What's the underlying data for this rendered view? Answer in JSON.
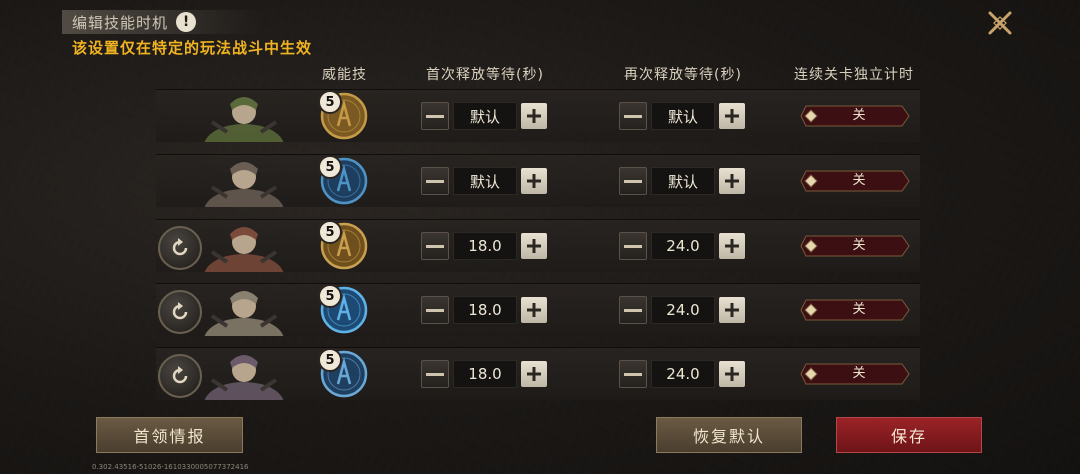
{
  "header": {
    "title": "编辑技能时机",
    "info_icon": "!",
    "subtitle": "该设置仅在特定的玩法战斗中生效"
  },
  "columns": {
    "skill": "威能技",
    "first_wait": "首次释放等待(秒)",
    "repeat_wait": "再次释放等待(秒)",
    "independent_timer": "连续关卡独立计时"
  },
  "rows": [
    {
      "has_reset": false,
      "portrait": "hero-green-armored",
      "skill_level": "5",
      "skill_icon": "gold-hooded-figure-icon",
      "first": "默认",
      "repeat": "默认",
      "toggle": "关"
    },
    {
      "has_reset": false,
      "portrait": "hero-bearded-warrior",
      "skill_level": "5",
      "skill_icon": "blue-trident-icon",
      "first": "默认",
      "repeat": "默认",
      "toggle": "关"
    },
    {
      "has_reset": true,
      "portrait": "hero-dark-haired-woman",
      "skill_level": "5",
      "skill_icon": "gold-wing-icon",
      "first": "18.0",
      "repeat": "24.0",
      "toggle": "关"
    },
    {
      "has_reset": true,
      "portrait": "hero-hooded-mage",
      "skill_level": "5",
      "skill_icon": "blue-lightning-icon",
      "first": "18.0",
      "repeat": "24.0",
      "toggle": "关"
    },
    {
      "has_reset": true,
      "portrait": "hero-demon-lord",
      "skill_level": "5",
      "skill_icon": "blue-ice-shard-icon",
      "first": "18.0",
      "repeat": "24.0",
      "toggle": "关"
    }
  ],
  "footer": {
    "boss_info": "首领情报",
    "restore_default": "恢复默认",
    "save": "保存",
    "version": "0.302.43516-51026-1610330005077372416"
  },
  "colors": {
    "accent_gold": "#f0b321",
    "save_red": "#9b2327",
    "brown_button": "#6a5a44"
  }
}
